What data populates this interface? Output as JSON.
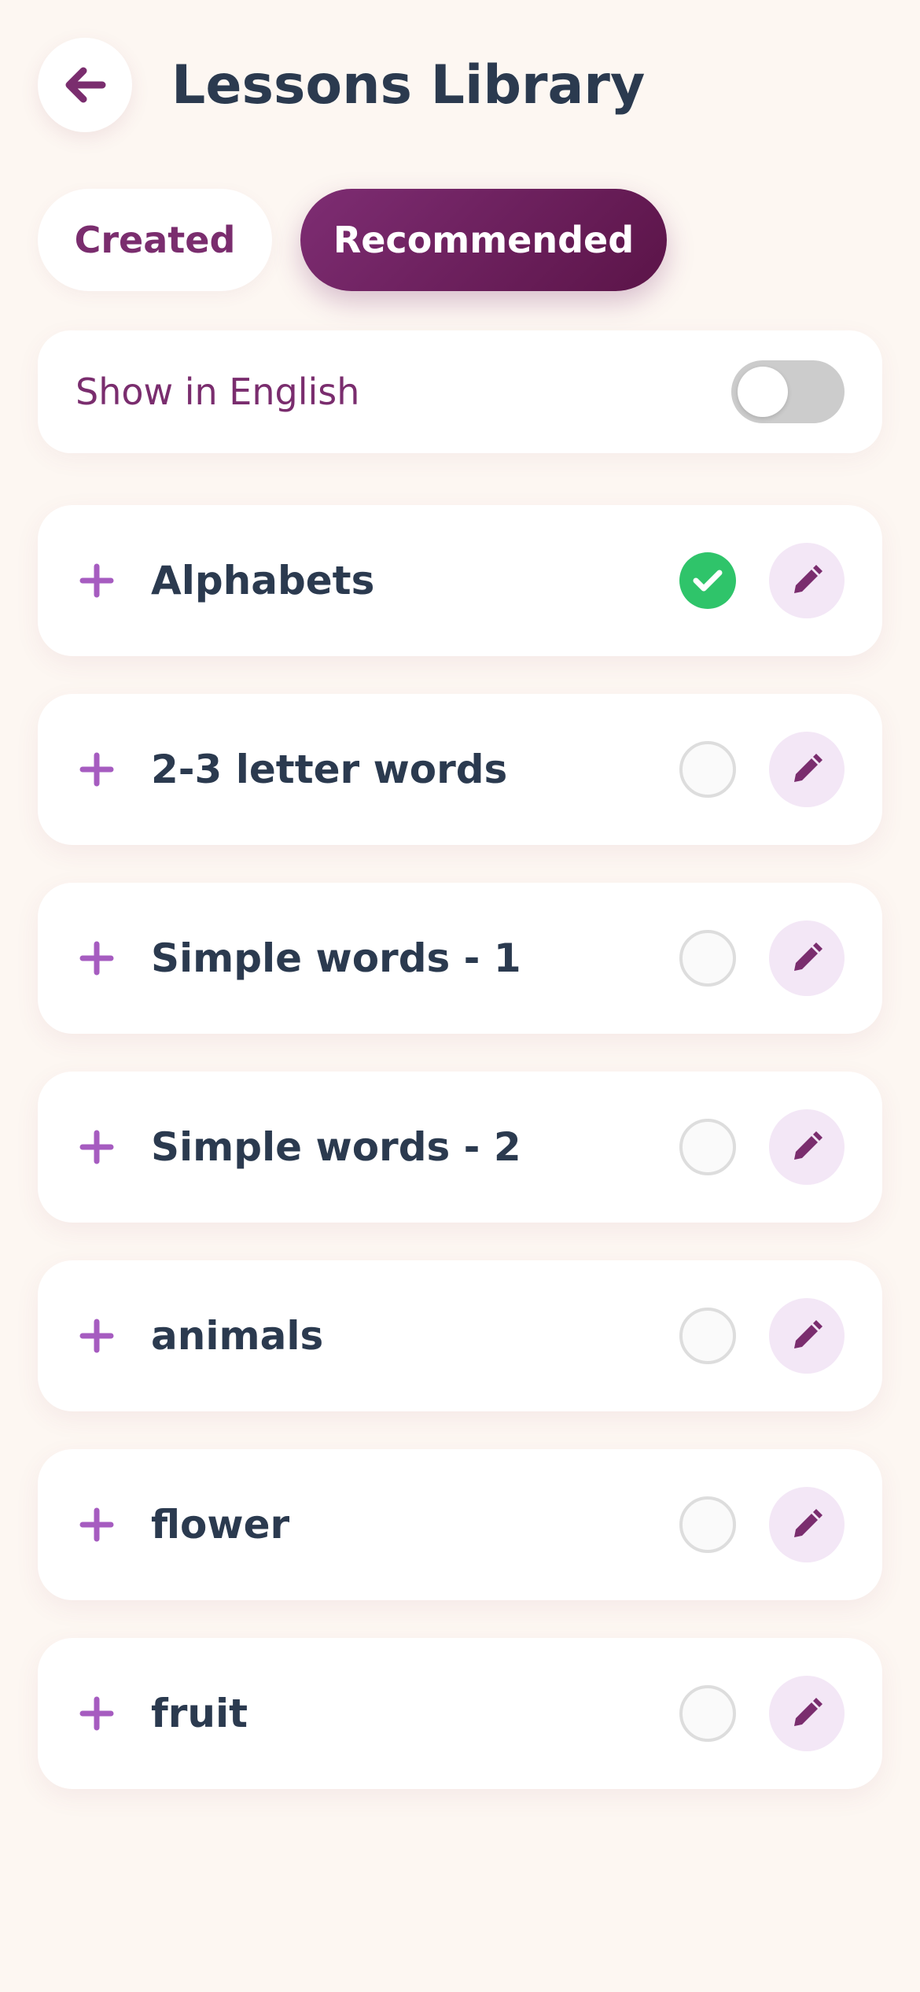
{
  "header": {
    "title": "Lessons Library",
    "back_icon": "arrow-left-icon"
  },
  "tabs": [
    {
      "label": "Created",
      "active": false
    },
    {
      "label": "Recommended",
      "active": true
    }
  ],
  "language_toggle": {
    "label": "Show in English",
    "enabled": false
  },
  "lessons": [
    {
      "name": "Alphabets",
      "completed": true
    },
    {
      "name": "2-3 letter words",
      "completed": false
    },
    {
      "name": "Simple words - 1",
      "completed": false
    },
    {
      "name": "Simple words - 2",
      "completed": false
    },
    {
      "name": "animals",
      "completed": false
    },
    {
      "name": "flower",
      "completed": false
    },
    {
      "name": "fruit",
      "completed": false
    }
  ],
  "icons": {
    "expand": "plus-icon",
    "completed": "check-icon",
    "edit": "pencil-icon"
  },
  "colors": {
    "brand": "#7A2D6E",
    "brand_dark": "#5B1448",
    "plus": "#A65CC0",
    "completed": "#2FC46A",
    "title_text": "#2B3A4F",
    "background": "#FDF7F2"
  }
}
